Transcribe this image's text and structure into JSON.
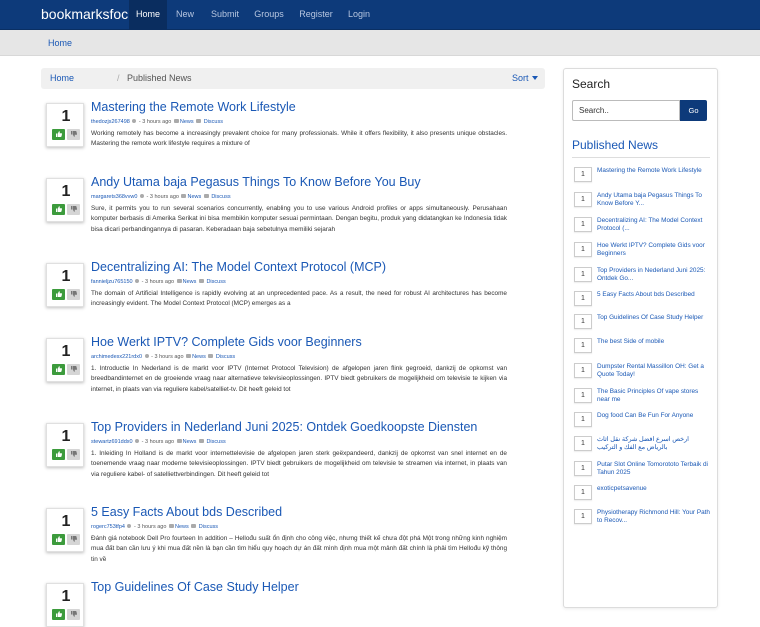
{
  "nav": {
    "brand": "bookmarksfocus",
    "links": [
      "Home",
      "New",
      "Submit",
      "Groups",
      "Register",
      "Login"
    ],
    "active": "Home"
  },
  "subnav": {
    "home": "Home"
  },
  "breadcrumb": {
    "home": "Home",
    "separator": "/",
    "current": "Published News",
    "sort": "Sort"
  },
  "colors": {
    "navbar": "#0d3a7a",
    "link": "#1a58b5",
    "upvote": "#3c9b3c"
  },
  "posts": [
    {
      "votes": "1",
      "title": "Mastering the Remote Work Lifestyle",
      "author": "thedozjs267498",
      "time": "- 3 hours ago",
      "category": "News",
      "discuss": "Discuss",
      "desc": "Working remotely has become a increasingly prevalent choice for many professionals. While it offers flexibility, it also presents unique obstacles. Mastering the remote work lifestyle requires a mixture of"
    },
    {
      "votes": "1",
      "title": "Andy Utama baja Pegasus Things To Know Before You Buy",
      "author": "margarets368vvw0",
      "time": "- 3 hours ago",
      "category": "News",
      "discuss": "Discuss",
      "desc": "Sure, it permits you to run several scenarios concurrently, enabling you to use various Android profiles or apps simultaneously. Perusahaan komputer berbasis di Amerika Serikat ini bisa membikin komputer sesuai permintaan. Dengan begitu, produk yang didatangkan ke Indonesia tidak bisa dicari perbandingannya di pasaran. Keberadaan baja sebetulnya memiliki sejarah"
    },
    {
      "votes": "1",
      "title": "Decentralizing AI: The Model Context Protocol (MCP)",
      "author": "fannieljzu765150",
      "time": "- 3 hours ago",
      "category": "News",
      "discuss": "Discuss",
      "desc": "The domain of Artificial Intelligence is rapidly evolving at an unprecedented pace. As a result, the need for robust AI architectures has become increasingly evident. The Model Context Protocol (MCP) emerges as a"
    },
    {
      "votes": "1",
      "title": "Hoe Werkt IPTV? Complete Gids voor Beginners",
      "author": "archimedesx221rdx0",
      "time": "- 3 hours ago",
      "category": "News",
      "discuss": "Discuss",
      "desc": "1. Introductie In Nederland is de markt voor IPTV (Internet Protocol Television) de afgelopen jaren flink gegroeid, dankzij de opkomst van breedbandinternet en de groeiende vraag naar alternatieve televisieoplossingen. IPTV biedt gebruikers de mogelijkheid om televisie te kijken via internet, in plaats van via reguliere kabel/satelliet-tv. Dit heeft geleid tot"
    },
    {
      "votes": "1",
      "title": "Top Providers in Nederland Juni 2025: Ontdek Goedkoopste Diensten",
      "author": "stewartz691ddx0",
      "time": "- 3 hours ago",
      "category": "News",
      "discuss": "Discuss",
      "desc": "1. Inleiding In Holland is de markt voor internettelevisie de afgelopen jaren sterk geëxpandeerd, dankzij de opkomst van snel internet en de toenemende vraag naar moderne televisieoplossingen. IPTV biedt gebruikers de mogelijkheid om televisie te streamen via internet, in plaats van via reguliere kabel- of satelliettverbindingen. Dit heeft geleid tot"
    },
    {
      "votes": "1",
      "title": "5 Easy Facts About bds Described",
      "author": "rogerc753tfp4",
      "time": "- 3 hours ago",
      "category": "News",
      "discuss": "Discuss",
      "desc": "Đánh giá notebook Dell Pro fourteen In addition – Hellođu suất ổn định cho công việc, nhưng thiết kế chưa đột phá Một trong những kinh nghiệm mua đất ban cần lưu ý khi mua đất nền là bạn cần tìm hiểu quy hoạch dự án đất mình định mua một mảnh đất chính là phải tìm Hellođu kỹ thông tin về"
    },
    {
      "votes": "1",
      "title": "Top Guidelines Of Case Study Helper",
      "author": "",
      "time": "",
      "category": "",
      "discuss": "",
      "desc": ""
    }
  ],
  "sidebar": {
    "search_title": "Search",
    "search_placeholder": "Search..",
    "search_button": "Go",
    "published_title": "Published News",
    "items": [
      {
        "count": "1",
        "label": "Mastering the Remote Work Lifestyle"
      },
      {
        "count": "1",
        "label": "Andy Utama baja Pegasus Things To Know Before Y..."
      },
      {
        "count": "1",
        "label": "Decentralizing AI: The Model Context Protocol (..."
      },
      {
        "count": "1",
        "label": "Hoe Werkt IPTV? Complete Gids voor Beginners"
      },
      {
        "count": "1",
        "label": "Top Providers in Nederland Juni 2025: Ontdek Go..."
      },
      {
        "count": "1",
        "label": "5 Easy Facts About bds Described"
      },
      {
        "count": "1",
        "label": "Top Guidelines Of Case Study Helper"
      },
      {
        "count": "1",
        "label": "The best Side of mobile"
      },
      {
        "count": "1",
        "label": "Dumpster Rental Massillon OH: Get a Quote Today!"
      },
      {
        "count": "1",
        "label": "The Basic Principles Of vape stores near me"
      },
      {
        "count": "1",
        "label": "Dog food Can Be Fun For Anyone"
      },
      {
        "count": "1",
        "label": "ارخص اسرع افضل شركة نقل اثاث بالرياض مع الفك و التركيب"
      },
      {
        "count": "1",
        "label": "Putar Slot Online Tomorototo Terbaik di Tahun 2025"
      },
      {
        "count": "1",
        "label": "exoticpetsavenue"
      },
      {
        "count": "1",
        "label": "Physiotherapy Richmond Hill: Your Path to Recov..."
      }
    ]
  }
}
